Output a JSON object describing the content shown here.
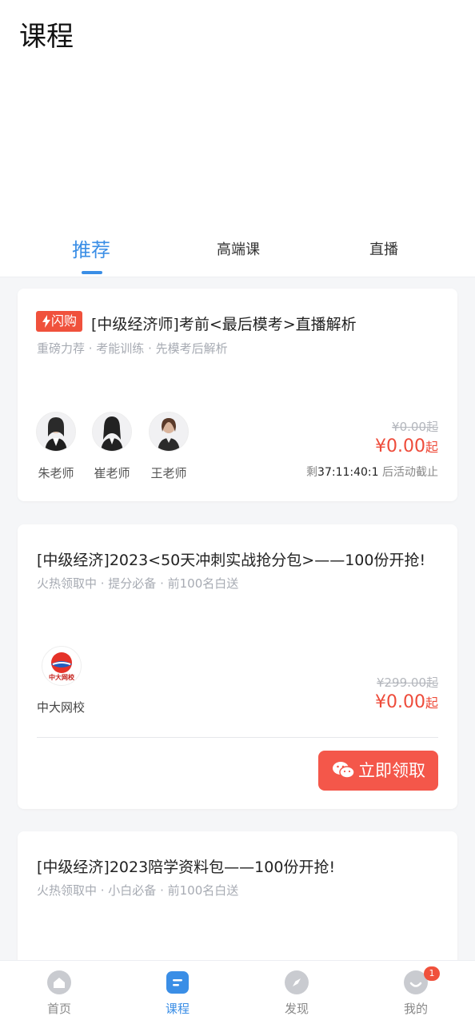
{
  "header": {
    "title": "课程"
  },
  "tabs": [
    {
      "label": "推荐",
      "active": true
    },
    {
      "label": "高端课",
      "active": false
    },
    {
      "label": "直播",
      "active": false
    }
  ],
  "cards": [
    {
      "badge": "闪购",
      "title": "[中级经济师]考前<最后模考>直播解析",
      "subtitle": "重磅力荐 · 考能训练 · 先模考后解析",
      "teachers": [
        {
          "name": "朱老师"
        },
        {
          "name": "崔老师"
        },
        {
          "name": "王老师"
        }
      ],
      "price_old": "¥0.00起",
      "price_new": "¥0.00",
      "price_suffix": "起",
      "countdown_prefix": "剩",
      "countdown_time": "37:11:40:1",
      "countdown_suffix": " 后活动截止"
    },
    {
      "title": "[中级经济]2023<50天冲刺实战抢分包>——100份开抢!",
      "subtitle": "火热领取中 · 提分必备 · 前100名白送",
      "school": "中大网校",
      "logo_text": "中大网校",
      "price_old": "¥299.00起",
      "price_new": "¥0.00",
      "price_suffix": "起",
      "button": "立即领取"
    },
    {
      "title": "[中级经济]2023陪学资料包——100份开抢!",
      "subtitle": "火热领取中 · 小白必备 · 前100名白送"
    }
  ],
  "bottom_nav": [
    {
      "label": "首页",
      "icon": "home-icon",
      "active": false
    },
    {
      "label": "课程",
      "icon": "course-icon",
      "active": true
    },
    {
      "label": "发现",
      "icon": "compass-icon",
      "active": false
    },
    {
      "label": "我的",
      "icon": "profile-icon",
      "active": false,
      "badge": "1"
    }
  ],
  "colors": {
    "accent": "#3a8ee6",
    "price": "#ee4b3a",
    "button": "#f4574a"
  }
}
